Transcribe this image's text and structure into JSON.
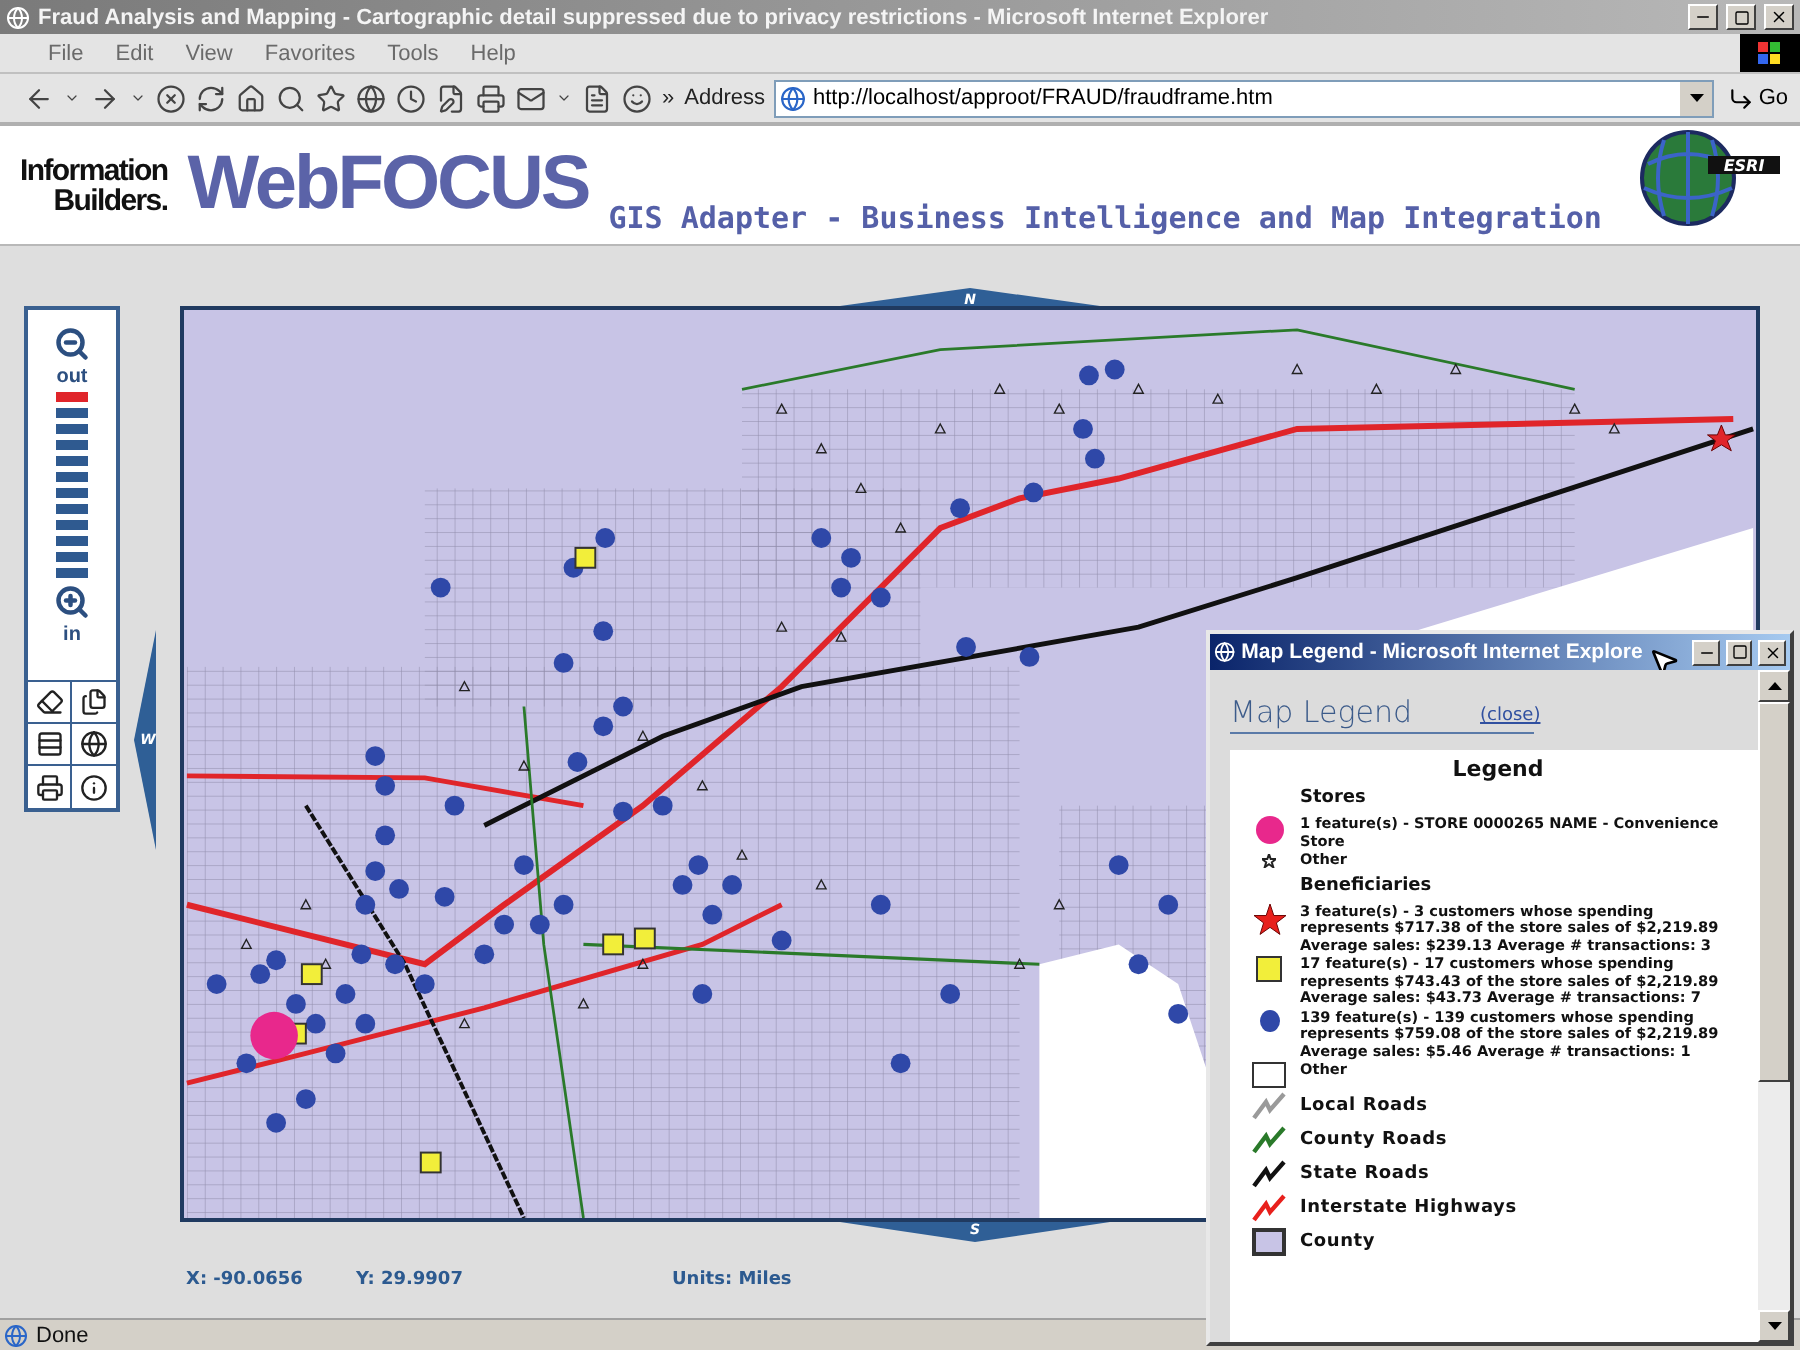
{
  "window": {
    "title": "Fraud Analysis and Mapping - Cartographic detail suppressed due to privacy restrictions - Microsoft Internet Explorer"
  },
  "menu": [
    "File",
    "Edit",
    "View",
    "Favorites",
    "Tools",
    "Help"
  ],
  "toolbar": {
    "more": "»",
    "address_label": "Address",
    "url": "http://localhost/approot/FRAUD/fraudframe.htm",
    "go": "Go"
  },
  "header": {
    "brand_top": "Information",
    "brand_bottom": "Builders.",
    "product": "WebFOCUS",
    "subtitle": "GIS Adapter - Business Intelligence and Map Integration",
    "partner": "ESRI"
  },
  "map": {
    "north": "N",
    "south": "S",
    "west": "W"
  },
  "zoom": {
    "out": "out",
    "in": "in",
    "steps": [
      {
        "selected": true
      },
      {
        "selected": false
      },
      {
        "selected": false
      },
      {
        "selected": false
      },
      {
        "selected": false
      },
      {
        "selected": false
      },
      {
        "selected": false
      },
      {
        "selected": false
      },
      {
        "selected": false
      },
      {
        "selected": false
      },
      {
        "selected": false
      },
      {
        "selected": false
      }
    ]
  },
  "coords": {
    "x": "X: -90.0656",
    "y": "Y: 29.9907",
    "units": "Units: Miles"
  },
  "legend_window": {
    "title": "Map Legend - Microsoft Internet Explore",
    "heading": "Map Legend",
    "close": "(close)",
    "legend_title": "Legend",
    "groups": [
      {
        "title": "Stores",
        "items": [
          {
            "kind": "circle",
            "color": "#e8288c",
            "text": "1 feature(s) - STORE 0000265 NAME - Convenience Store"
          },
          {
            "kind": "small-star",
            "color": "#222222",
            "text": "Other"
          }
        ]
      },
      {
        "title": "Beneficiaries",
        "items": [
          {
            "kind": "star",
            "color": "#e8201c",
            "text": "3 feature(s) - 3 customers whose spending represents $717.38 of the store sales of $2,219.89 Average sales: $239.13 Average # transactions: 3"
          },
          {
            "kind": "square",
            "color": "#f2ee3a",
            "text": "17 feature(s) - 17 customers whose spending represents $743.43 of the store sales of $2,219.89 Average sales: $43.73 Average # transactions: 7"
          },
          {
            "kind": "dot",
            "color": "#2f48a8",
            "text": "139 feature(s) - 139 customers whose spending represents $759.08 of the store sales of $2,219.89 Average sales: $5.46 Average # transactions: 1"
          },
          {
            "kind": "box",
            "color": "#ffffff",
            "text": "Other"
          },
          {
            "kind": "line",
            "color": "#9a9a9a",
            "text": "Local Roads"
          },
          {
            "kind": "line",
            "color": "#2a7a2a",
            "text": "County Roads"
          },
          {
            "kind": "line",
            "color": "#111111",
            "text": "State Roads"
          },
          {
            "kind": "line",
            "color": "#e8201c",
            "text": "Interstate Highways"
          },
          {
            "kind": "fill",
            "color": "#c8c4e6",
            "text": "County"
          }
        ]
      }
    ]
  },
  "status": "Done"
}
